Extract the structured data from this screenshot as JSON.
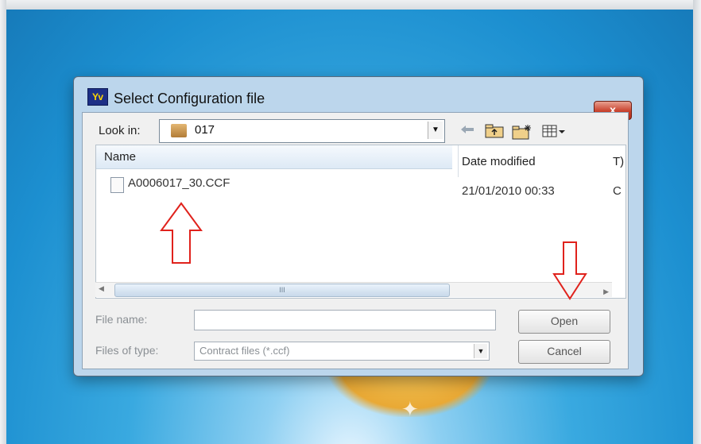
{
  "dialog": {
    "icon_text": "Yv",
    "title": "Select Configuration file",
    "close_label": "x"
  },
  "look_in": {
    "label": "Look in:",
    "value": "017"
  },
  "toolbar": {
    "back_icon": "back-arrow-icon",
    "up_icon": "up-folder-icon",
    "new_folder_icon": "new-folder-icon",
    "view_icon": "view-menu-icon"
  },
  "file_list": {
    "columns": {
      "name": "Name",
      "date": "Date modified",
      "type": "T)"
    },
    "rows": [
      {
        "name": "A0006017_30.CCF",
        "date": "21/01/2010 00:33",
        "type": "C"
      }
    ],
    "scroll_grip": "III"
  },
  "form": {
    "file_name_label": "File name:",
    "file_name_value": "",
    "file_type_label": "Files of type:",
    "file_type_value": "Contract files (*.ccf)"
  },
  "buttons": {
    "open": "Open",
    "cancel": "Cancel"
  },
  "annotations": {
    "color": "#e0221c"
  }
}
